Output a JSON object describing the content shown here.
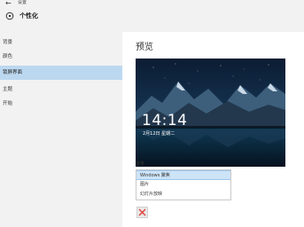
{
  "titlebar": {
    "top_label": "设置",
    "app_title": "个性化"
  },
  "sidebar": {
    "items": [
      {
        "label": "背景",
        "selected": false
      },
      {
        "label": "颜色",
        "selected": false
      },
      {
        "label": "锁屏界面",
        "selected": true
      },
      {
        "label": "主题",
        "selected": false
      },
      {
        "label": "开始",
        "selected": false
      }
    ]
  },
  "main": {
    "section_title": "预览",
    "lock_preview": {
      "time": "14:14",
      "date": "2月12日 星期二"
    },
    "background_label": "背景",
    "dropdown": {
      "options": [
        {
          "label": "Windows 聚焦",
          "selected": true
        },
        {
          "label": "图片",
          "selected": false
        },
        {
          "label": "幻灯片放映",
          "selected": false
        }
      ]
    }
  },
  "colors": {
    "accent": "#bcd8f0",
    "sidebar_bg": "#f2f2f2",
    "close_x": "#e0433a"
  },
  "icons": {
    "back": "back-arrow-icon",
    "home": "home-icon",
    "close": "close-icon"
  }
}
